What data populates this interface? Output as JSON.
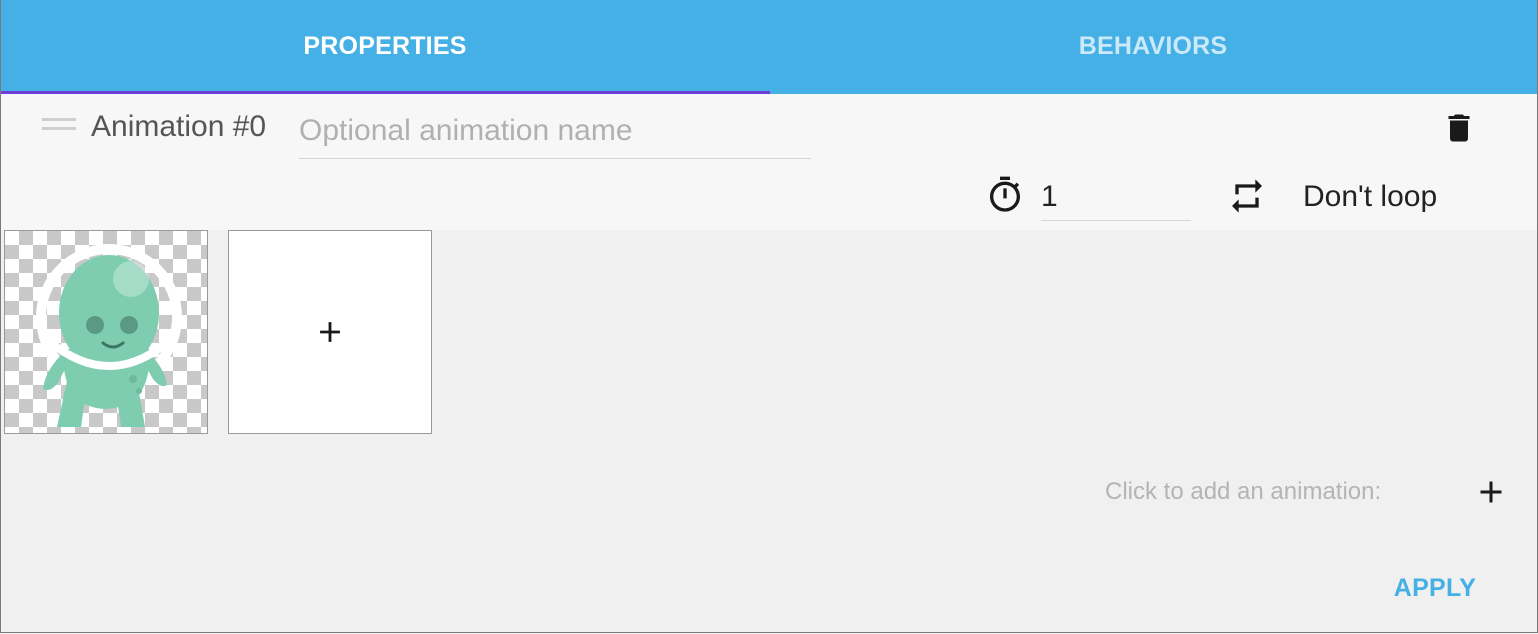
{
  "tabs": [
    {
      "label": "PROPERTIES",
      "active": true
    },
    {
      "label": "BEHAVIORS",
      "active": false
    }
  ],
  "animation": {
    "label": "Animation #0",
    "name_value": "",
    "name_placeholder": "Optional animation name",
    "duration_value": "1",
    "loop_label": "Don't loop"
  },
  "sprite": {
    "description_icon": "alien-sprite"
  },
  "footer": {
    "add_animation_label": "Click to add an animation:",
    "apply_label": "APPLY"
  },
  "colors": {
    "tab_bar": "#44b0e6",
    "tab_indicator": "#6c3fd8",
    "accent": "#44b0e6",
    "sprite_green": "#7ecdb0"
  },
  "icons": {
    "drag": "drag-handle-icon",
    "trash": "trash-icon",
    "timer": "timer-icon",
    "loop": "loop-icon",
    "add_frame": "plus-icon",
    "add_animation": "plus-icon"
  }
}
